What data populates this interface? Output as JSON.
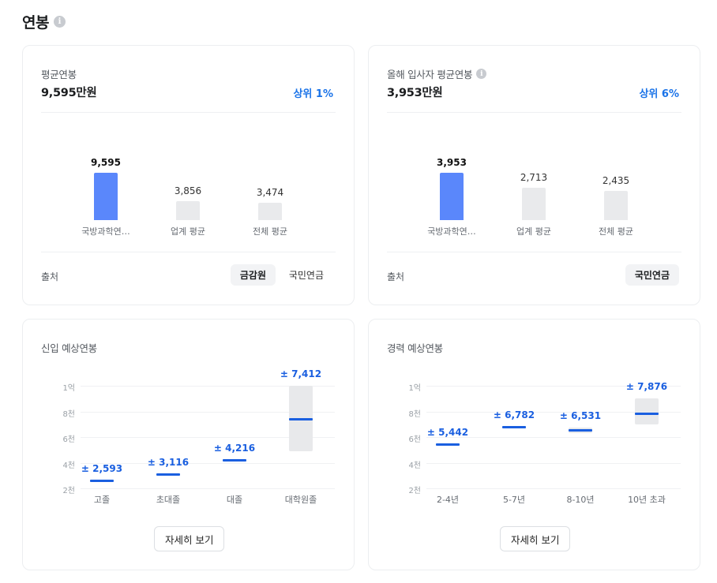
{
  "page": {
    "title": "연봉"
  },
  "average_salary": {
    "label": "평균연봉",
    "amount": "9,595만원",
    "rank": "상위 1%",
    "bars": [
      {
        "value": "9,595",
        "label": "국방과학연…",
        "amount": 9595
      },
      {
        "value": "3,856",
        "label": "업계 평균",
        "amount": 3856
      },
      {
        "value": "3,474",
        "label": "전체 평균",
        "amount": 3474
      }
    ],
    "source_label": "출처",
    "sources": [
      "금감원",
      "국민연금"
    ]
  },
  "new_hire_salary": {
    "label": "올해 입사자 평균연봉",
    "amount": "3,953만원",
    "rank": "상위 6%",
    "bars": [
      {
        "value": "3,953",
        "label": "국방과학연…",
        "amount": 3953
      },
      {
        "value": "2,713",
        "label": "업계 평균",
        "amount": 2713
      },
      {
        "value": "2,435",
        "label": "전체 평균",
        "amount": 2435
      }
    ],
    "source_label": "출처",
    "sources": [
      "국민연금"
    ]
  },
  "entry_salary": {
    "label": "신입 예상연봉",
    "y_ticks": [
      "1억",
      "8천",
      "6천",
      "4천",
      "2천"
    ],
    "groups": [
      {
        "label": "고졸",
        "value_label": "± 2,593",
        "value": 2593,
        "low": 2593,
        "high": 2593
      },
      {
        "label": "초대졸",
        "value_label": "± 3,116",
        "value": 3116,
        "low": 3116,
        "high": 3116
      },
      {
        "label": "대졸",
        "value_label": "± 4,216",
        "value": 4216,
        "low": 4216,
        "high": 4216
      },
      {
        "label": "대학원졸",
        "value_label": "± 7,412",
        "value": 7412,
        "low": 4900,
        "high": 10000
      }
    ],
    "detail_button": "자세히 보기"
  },
  "career_salary": {
    "label": "경력 예상연봉",
    "y_ticks": [
      "1억",
      "8천",
      "6천",
      "4천",
      "2천"
    ],
    "groups": [
      {
        "label": "2-4년",
        "value_label": "± 5,442",
        "value": 5442,
        "low": 5442,
        "high": 5442
      },
      {
        "label": "5-7년",
        "value_label": "± 6,782",
        "value": 6782,
        "low": 6782,
        "high": 6782
      },
      {
        "label": "8-10년",
        "value_label": "± 6,531",
        "value": 6531,
        "low": 6300,
        "high": 6750
      },
      {
        "label": "10년 초과",
        "value_label": "± 7,876",
        "value": 7876,
        "low": 7000,
        "high": 9000
      }
    ],
    "detail_button": "자세히 보기"
  },
  "colors": {
    "accent": "#1a73e8",
    "primary_bar": "#5a87fb",
    "secondary_bar": "#e9eaec",
    "marker": "#1a5fe0"
  }
}
